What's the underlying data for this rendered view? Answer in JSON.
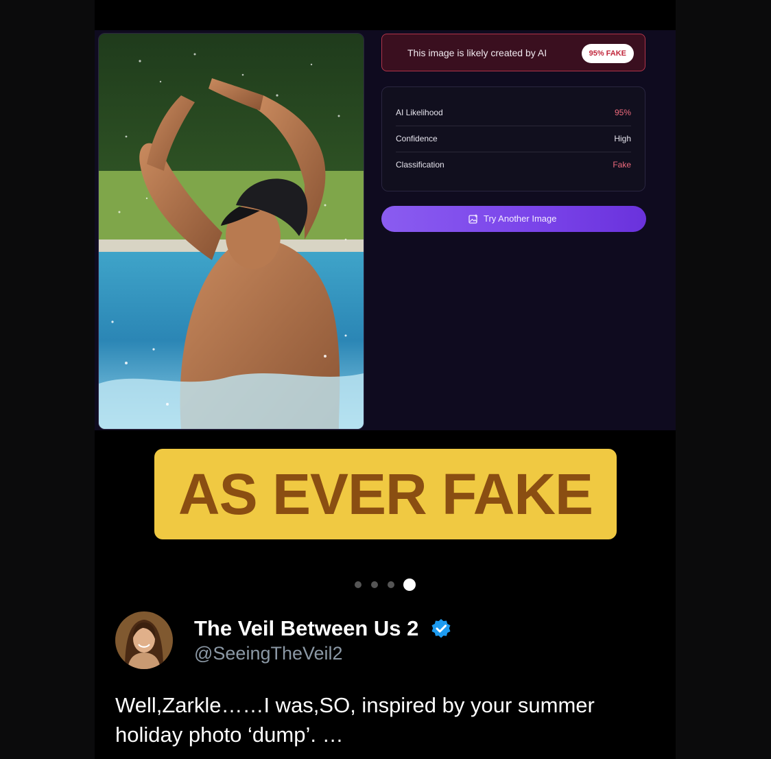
{
  "detector": {
    "verdict_text": "This image is likely created by AI",
    "verdict_badge": "95% FAKE",
    "stats": [
      {
        "label": "AI Likelihood",
        "value": "95%"
      },
      {
        "label": "Confidence",
        "value": "High"
      },
      {
        "label": "Classification",
        "value": "Fake"
      }
    ],
    "try_button_label": "Try Another Image",
    "accent_color": "#7b45ea",
    "fake_color": "#ef6b7d"
  },
  "caption": "AS EVER FAKE",
  "carousel": {
    "total": 4,
    "active_index": 3
  },
  "tweet": {
    "display_name": "The Veil Between Us 2",
    "handle": "@SeeingTheVeil2",
    "verified": true,
    "text": "Well,Zarkle……I was,SO, inspired by your summer holiday photo ‘dump’. …"
  }
}
